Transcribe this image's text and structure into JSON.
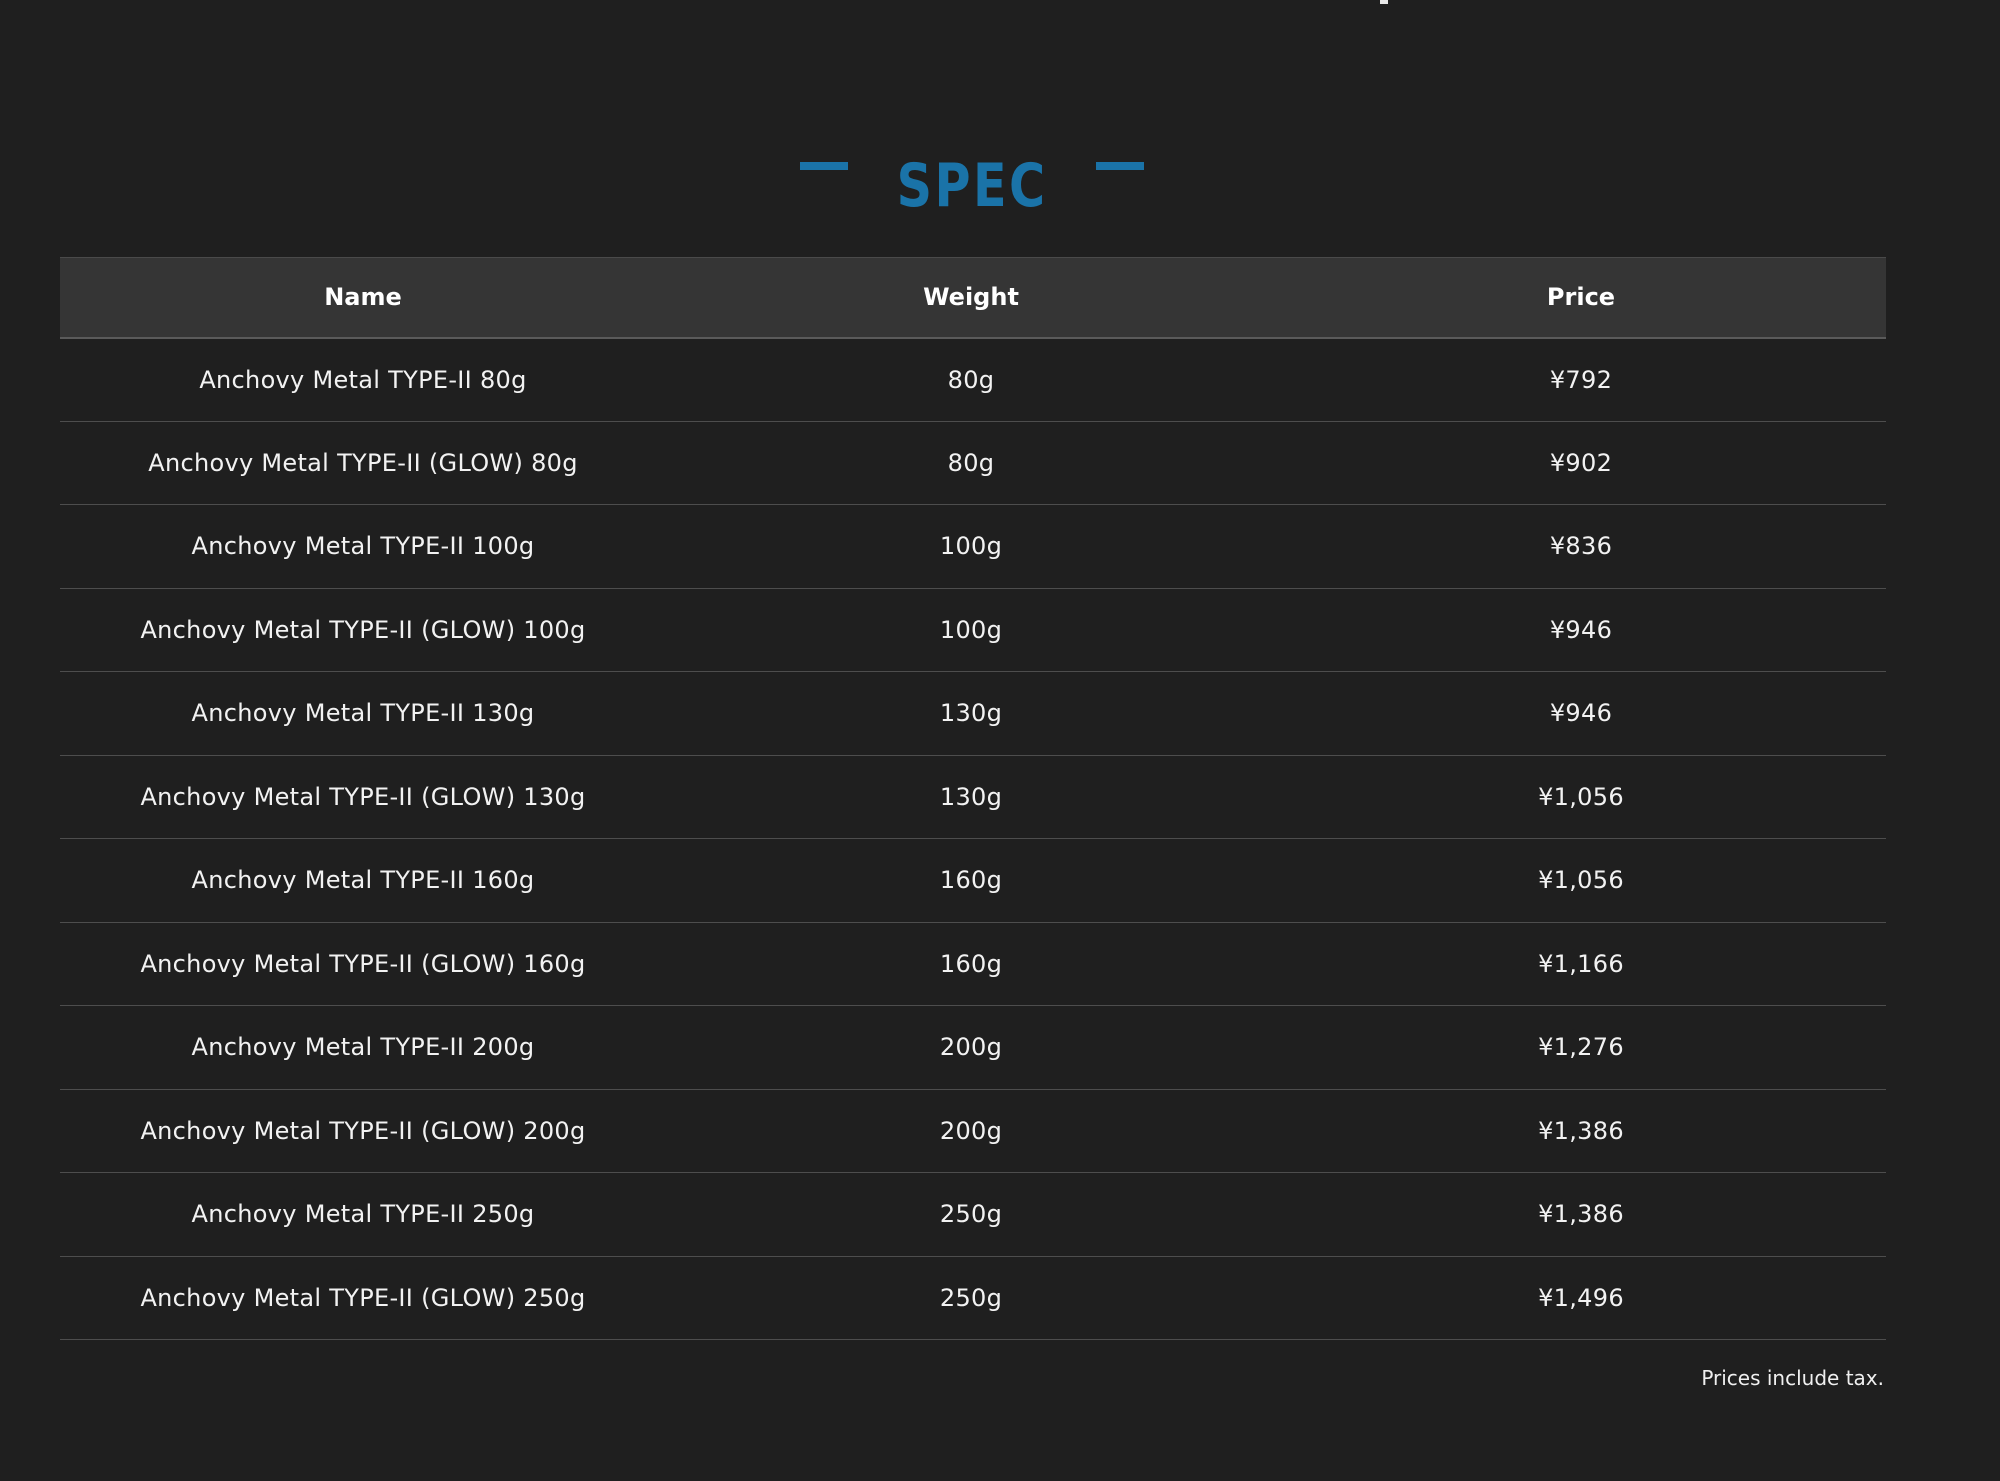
{
  "section": {
    "title": "SPEC"
  },
  "table": {
    "headers": {
      "name": "Name",
      "weight": "Weight",
      "price": "Price"
    },
    "rows": [
      {
        "name": "Anchovy Metal TYPE-II 80g",
        "weight": "80g",
        "price": "¥792"
      },
      {
        "name": "Anchovy Metal TYPE-II (GLOW) 80g",
        "weight": "80g",
        "price": "¥902"
      },
      {
        "name": "Anchovy Metal TYPE-II 100g",
        "weight": "100g",
        "price": "¥836"
      },
      {
        "name": "Anchovy Metal TYPE-II (GLOW) 100g",
        "weight": "100g",
        "price": "¥946"
      },
      {
        "name": "Anchovy Metal TYPE-II 130g",
        "weight": "130g",
        "price": "¥946"
      },
      {
        "name": "Anchovy Metal TYPE-II (GLOW) 130g",
        "weight": "130g",
        "price": "¥1,056"
      },
      {
        "name": "Anchovy Metal TYPE-II 160g",
        "weight": "160g",
        "price": "¥1,056"
      },
      {
        "name": "Anchovy Metal TYPE-II (GLOW) 160g",
        "weight": "160g",
        "price": "¥1,166"
      },
      {
        "name": "Anchovy Metal TYPE-II 200g",
        "weight": "200g",
        "price": "¥1,276"
      },
      {
        "name": "Anchovy Metal TYPE-II (GLOW) 200g",
        "weight": "200g",
        "price": "¥1,386"
      },
      {
        "name": "Anchovy Metal TYPE-II 250g",
        "weight": "250g",
        "price": "¥1,386"
      },
      {
        "name": "Anchovy Metal TYPE-II (GLOW) 250g",
        "weight": "250g",
        "price": "¥1,496"
      }
    ]
  },
  "footer": {
    "note": "Prices include tax."
  },
  "colors": {
    "background": "#1f1f1f",
    "header_row": "#353535",
    "accent": "#1a73a8",
    "text": "#ffffff",
    "divider": "#4d4d4d"
  }
}
